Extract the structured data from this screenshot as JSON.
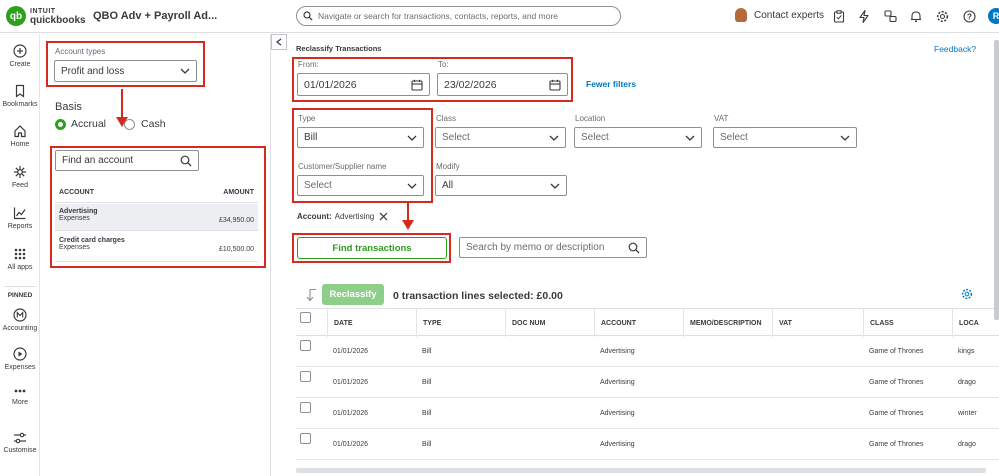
{
  "topbar": {
    "logo_intuit": "INTUIT",
    "logo_qb": "quickbooks",
    "company": "QBO Adv + Payroll Ad...",
    "search_placeholder": "Navigate or search for transactions, contacts, reports, and more",
    "contact_label": "Contact experts",
    "user_initial": "R"
  },
  "leftnav": {
    "items": [
      {
        "label": "Create",
        "icon": "plus-circle-icon"
      },
      {
        "label": "Bookmarks",
        "icon": "bookmark-icon"
      },
      {
        "label": "Home",
        "icon": "home-icon"
      },
      {
        "label": "Feed",
        "icon": "feed-icon"
      },
      {
        "label": "Reports",
        "icon": "reports-icon"
      },
      {
        "label": "All apps",
        "icon": "grid-icon"
      }
    ],
    "pinned_label": "PINNED",
    "pinned": [
      {
        "label": "Accounting",
        "icon": "accounting-icon"
      },
      {
        "label": "Expenses",
        "icon": "expenses-icon"
      },
      {
        "label": "More",
        "icon": "more-icon"
      },
      {
        "label": "Customise",
        "icon": "customise-icon"
      }
    ]
  },
  "sidepanel": {
    "account_types_label": "Account types",
    "account_types_value": "Profit and loss",
    "basis_label": "Basis",
    "basis_options": [
      "Accrual",
      "Cash"
    ],
    "basis_selected": "Accrual",
    "find_account_placeholder": "Find an account",
    "columns": [
      "ACCOUNT",
      "AMOUNT"
    ],
    "accounts": [
      {
        "name": "Advertising",
        "type": "Expenses",
        "amount": "£34,950.00"
      },
      {
        "name": "Credit card charges",
        "type": "Expenses",
        "amount": "£10,500.00"
      }
    ]
  },
  "main": {
    "title": "Reclassify Transactions",
    "feedback": "Feedback?",
    "from_label": "From:",
    "from_value": "01/01/2026",
    "to_label": "To:",
    "to_value": "23/02/2026",
    "fewer_filters": "Fewer filters",
    "type_label": "Type",
    "type_value": "Bill",
    "class_label": "Class",
    "class_placeholder": "Select",
    "location_label": "Location",
    "location_placeholder": "Select",
    "vat_label": "VAT",
    "vat_placeholder": "Select",
    "customer_label": "Customer/Supplier name",
    "customer_placeholder": "Select",
    "modify_label": "Modify",
    "modify_value": "All",
    "account_chip_label": "Account:",
    "account_chip_value": "Advertising",
    "find_button": "Find transactions",
    "memo_search_placeholder": "Search by memo or description",
    "reclassify_button": "Reclassify",
    "selected_text": "0 transaction lines selected: £0.00",
    "columns": [
      "DATE",
      "TYPE",
      "DOC NUM",
      "ACCOUNT",
      "MEMO/DESCRIPTION",
      "VAT",
      "CLASS",
      "LOCA"
    ],
    "rows": [
      {
        "date": "01/01/2026",
        "type": "Bill",
        "doc": "",
        "account": "Advertising",
        "memo": "",
        "vat": "",
        "class": "Game of Thrones",
        "location": "kings"
      },
      {
        "date": "01/01/2026",
        "type": "Bill",
        "doc": "",
        "account": "Advertising",
        "memo": "",
        "vat": "",
        "class": "Game of Thrones",
        "location": "drago"
      },
      {
        "date": "01/01/2026",
        "type": "Bill",
        "doc": "",
        "account": "Advertising",
        "memo": "",
        "vat": "",
        "class": "Game of Thrones",
        "location": "winter"
      },
      {
        "date": "01/01/2026",
        "type": "Bill",
        "doc": "",
        "account": "Advertising",
        "memo": "",
        "vat": "",
        "class": "Game of Thrones",
        "location": "drago"
      }
    ]
  },
  "colors": {
    "brand_green": "#2ca01c",
    "annotation_red": "#d52b1e",
    "link_blue": "#0077c5"
  }
}
